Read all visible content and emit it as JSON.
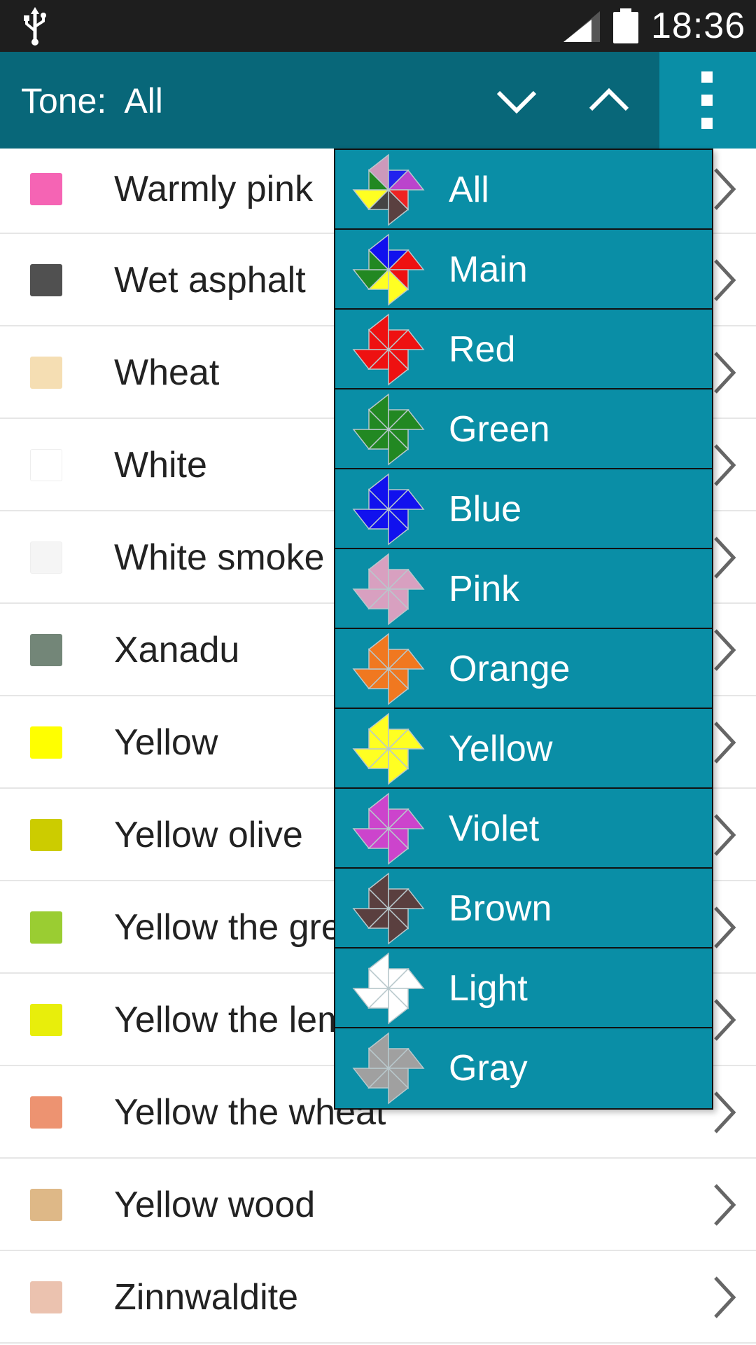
{
  "status_bar": {
    "time": "18:36",
    "icons": [
      "usb-icon",
      "signal-icon",
      "battery-icon"
    ]
  },
  "app_bar": {
    "tone_label": "Tone:  All",
    "icons": [
      "chevron-down-icon",
      "chevron-up-icon",
      "overflow-menu-icon"
    ]
  },
  "colors": {
    "app_bar": "#086779",
    "menu_background": "#0a8ea6",
    "status_bar": "#1e1e1e"
  },
  "color_list": [
    {
      "name": "Warmly pink",
      "color": "#f564b4"
    },
    {
      "name": "Wet asphalt",
      "color": "#505050"
    },
    {
      "name": "Wheat",
      "color": "#f5deb3"
    },
    {
      "name": "White",
      "color": "#ffffff"
    },
    {
      "name": "White smoke",
      "color": "#f5f5f5"
    },
    {
      "name": "Xanadu",
      "color": "#738678"
    },
    {
      "name": "Yellow",
      "color": "#ffff00"
    },
    {
      "name": "Yellow olive",
      "color": "#cccc00"
    },
    {
      "name": "Yellow the green",
      "color": "#9acd32"
    },
    {
      "name": "Yellow the lemon",
      "color": "#e8ee0b"
    },
    {
      "name": "Yellow the wheat",
      "color": "#ed9371"
    },
    {
      "name": "Yellow wood",
      "color": "#deb887"
    },
    {
      "name": "Zinnwaldite",
      "color": "#ebc2af"
    }
  ],
  "tone_menu": [
    {
      "label": "All",
      "colors": [
        "#cc99bb",
        "#bb44cc",
        "#5a4040",
        "#ffff22",
        "#2222ee",
        "#ee2222",
        "#444444",
        "#228822"
      ]
    },
    {
      "label": "Main",
      "colors": [
        "#1111ee",
        "#ee1111",
        "#ffff22",
        "#228822"
      ]
    },
    {
      "label": "Red",
      "colors": [
        "#ee1111"
      ]
    },
    {
      "label": "Green",
      "colors": [
        "#228822"
      ]
    },
    {
      "label": "Blue",
      "colors": [
        "#1111ee"
      ]
    },
    {
      "label": "Pink",
      "colors": [
        "#d8a0c0"
      ]
    },
    {
      "label": "Orange",
      "colors": [
        "#f07820"
      ]
    },
    {
      "label": "Yellow",
      "colors": [
        "#ffff22"
      ]
    },
    {
      "label": "Violet",
      "colors": [
        "#cc44cc"
      ]
    },
    {
      "label": "Brown",
      "colors": [
        "#5a3f3f"
      ]
    },
    {
      "label": "Light",
      "colors": [
        "#ffffff"
      ]
    },
    {
      "label": "Gray",
      "colors": [
        "#a0a0a0"
      ]
    }
  ]
}
